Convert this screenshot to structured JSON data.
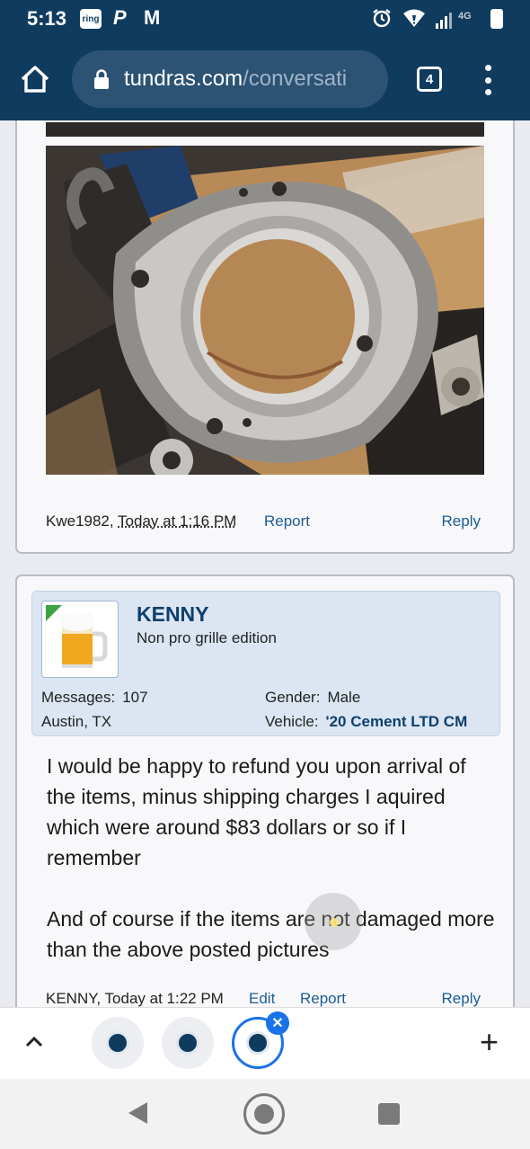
{
  "status_bar": {
    "time": "5:13",
    "notif_icons": [
      "ring-icon",
      "paypal-icon",
      "gmail-icon"
    ],
    "ring_label": "ring",
    "network": "4G"
  },
  "browser": {
    "url_domain": "tundras.com",
    "url_path": "/conversati",
    "tab_count": "4"
  },
  "posts": [
    {
      "author": "Kwe1982",
      "timestamp": "Today at 1:16 PM",
      "report_label": "Report",
      "reply_label": "Reply"
    },
    {
      "username": "KENNY",
      "user_title": "Non pro grille edition",
      "messages_label": "Messages:",
      "messages_value": "107",
      "location": "Austin, TX",
      "gender_label": "Gender:",
      "gender_value": "Male",
      "vehicle_label": "Vehicle:",
      "vehicle_value": "'20 Cement LTD CM",
      "message_paragraphs": [
        "I would be happy to refund you upon arrival of the items, minus shipping charges I aquired which were around $83 dollars or so if I remember",
        "And of course if the items are not damaged more than the above posted pictures"
      ],
      "author": "KENNY",
      "timestamp": "Today at 1:22 PM",
      "edit_label": "Edit",
      "report_label": "Report",
      "reply_label": "Reply"
    }
  ],
  "colors": {
    "header_bg": "#0f3b5e",
    "link": "#1d5b94",
    "username": "#0e3f6d",
    "userbox_bg": "#dbe6f2",
    "accent_tab": "#1a73e8"
  }
}
